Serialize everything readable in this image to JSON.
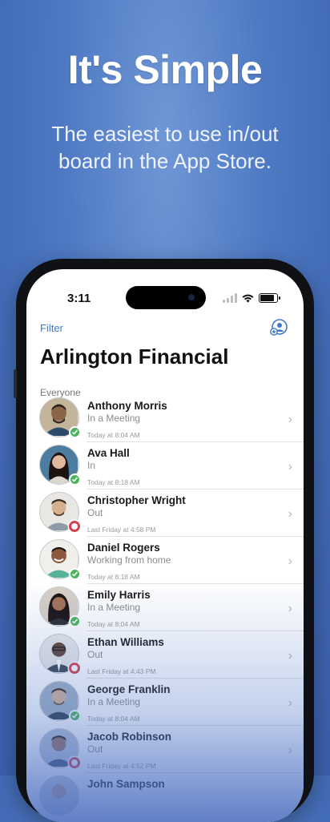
{
  "hero": {
    "title": "It's Simple",
    "subtitle_line1": "The easiest to use in/out",
    "subtitle_line2": "board in the App Store."
  },
  "status_bar": {
    "time": "3:11"
  },
  "nav": {
    "filter_label": "Filter",
    "add_user_icon": "add-user-icon"
  },
  "page": {
    "title": "Arlington Financial",
    "section": "Everyone"
  },
  "colors": {
    "in": "#4bb35a",
    "out": "#d4404f",
    "accent": "#3f78c7"
  },
  "people": [
    {
      "name": "Anthony Morris",
      "status": "In a Meeting",
      "time": "Today at 8:04 AM",
      "state": "in"
    },
    {
      "name": "Ava Hall",
      "status": "In",
      "time": "Today at 8:18 AM",
      "state": "in"
    },
    {
      "name": "Christopher Wright",
      "status": "Out",
      "time": "Last Friday at 4:58 PM",
      "state": "out"
    },
    {
      "name": "Daniel Rogers",
      "status": "Working from home",
      "time": "Today at 8:18 AM",
      "state": "in"
    },
    {
      "name": "Emily Harris",
      "status": "In a Meeting",
      "time": "Today at 8:04 AM",
      "state": "in"
    },
    {
      "name": "Ethan Williams",
      "status": "Out",
      "time": "Last Friday at 4:43 PM",
      "state": "out"
    },
    {
      "name": "George Franklin",
      "status": "In a Meeting",
      "time": "Today at 8:04 AM",
      "state": "in"
    },
    {
      "name": "Jacob Robinson",
      "status": "Out",
      "time": "Last Friday at 4:52 PM",
      "state": "out"
    },
    {
      "name": "John Sampson",
      "status": "",
      "time": "",
      "state": "in"
    }
  ]
}
